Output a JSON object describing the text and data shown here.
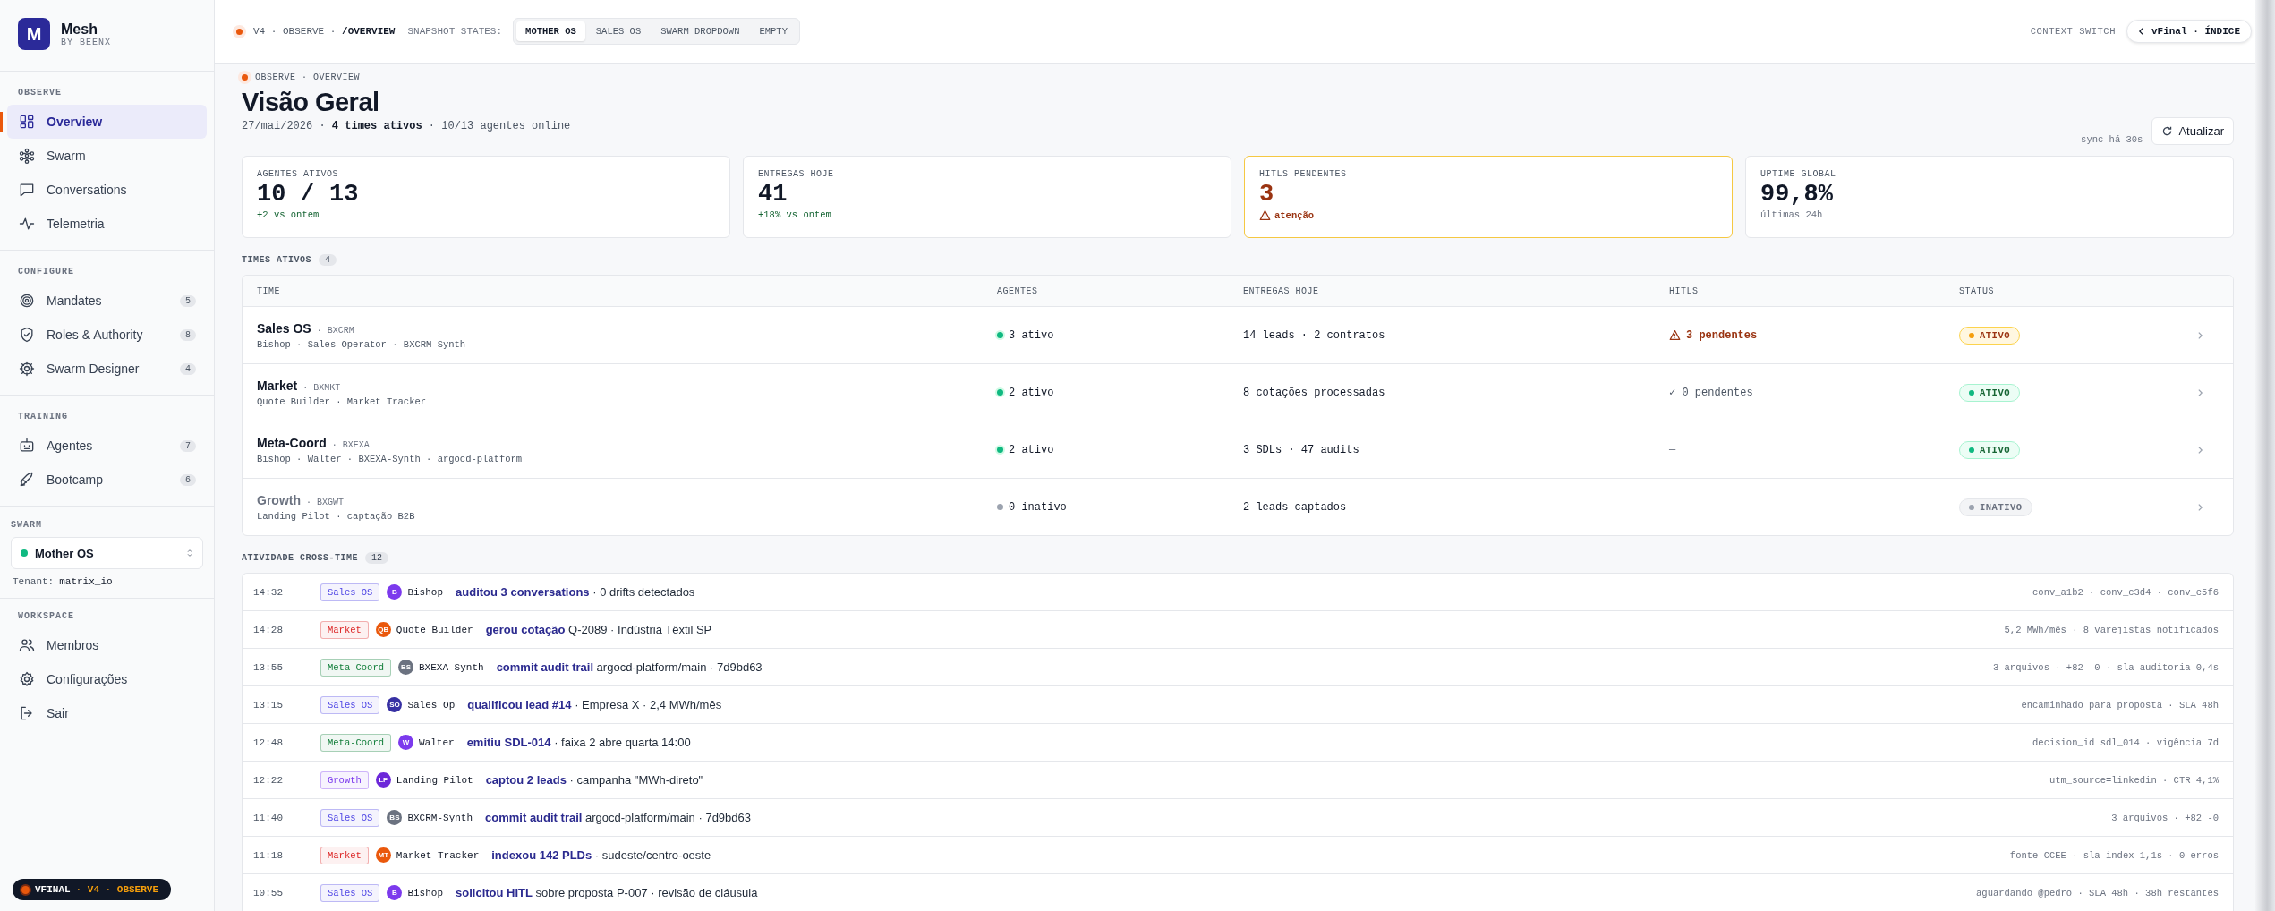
{
  "sidebar": {
    "brand": {
      "logo": "M",
      "name": "Mesh",
      "sub": "BY BEENX"
    },
    "sections": [
      {
        "title": "OBSERVE",
        "items": [
          {
            "label": "Overview",
            "selected": true
          },
          {
            "label": "Swarm",
            "selected": false
          },
          {
            "label": "Conversations",
            "selected": false
          },
          {
            "label": "Telemetria",
            "selected": false
          }
        ]
      },
      {
        "title": "CONFIGURE",
        "items": [
          {
            "label": "Mandates",
            "count": "5",
            "selected": false
          },
          {
            "label": "Roles & Authority",
            "count": "8",
            "selected": false
          },
          {
            "label": "Swarm Designer",
            "count": "4",
            "selected": false
          }
        ]
      },
      {
        "title": "TRAINING",
        "items": [
          {
            "label": "Agentes",
            "count": "7",
            "selected": false
          },
          {
            "label": "Bootcamp",
            "count": "6",
            "selected": false
          }
        ]
      }
    ],
    "swarm": {
      "title": "SWARM",
      "value": "Mother OS",
      "color": "#10b981",
      "tenant_label": "Tenant:",
      "tenant": "matrix_io"
    },
    "workspace": {
      "title": "WORKSPACE",
      "items": [
        {
          "label": "Membros",
          "selected": false
        },
        {
          "label": "Configurações",
          "selected": false
        },
        {
          "label": "Sair",
          "selected": false
        }
      ]
    },
    "footer": {
      "primary": "VFINAL",
      "secondary": "· V4 · OBSERVE"
    }
  },
  "topbar": {
    "breadcrumb": "V4 · OBSERVE · **/OVERVIEW**",
    "snapshot_label": "SNAPSHOT STATES:",
    "snapshots": [
      {
        "label": "MOTHER OS",
        "selected": true
      },
      {
        "label": "SALES OS",
        "selected": false
      },
      {
        "label": "SWARM DROPDOWN",
        "selected": false
      },
      {
        "label": "EMPTY",
        "selected": false
      }
    ],
    "context_label": "CONTEXT SWITCH",
    "back_link": "vFinal · ÍNDICE"
  },
  "header": {
    "eyebrow": "OBSERVE · OVERVIEW",
    "title": "Visão Geral",
    "subtitle": "27/mai/2026 · **4 times ativos** · 10/13 agentes online",
    "sync": "sync há 30s",
    "refresh": "Atualizar"
  },
  "stats": [
    {
      "label": "AGENTES ATIVOS",
      "value": "10 / 13",
      "note": "+2 vs ontem",
      "kind": "positive"
    },
    {
      "label": "ENTREGAS HOJE",
      "value": "41",
      "note": "+18% vs ontem",
      "kind": "positive"
    },
    {
      "label": "HITLS PENDENTES",
      "value": "3",
      "note": "atenção",
      "kind": "warning"
    },
    {
      "label": "UPTIME GLOBAL",
      "value": "99,8%",
      "note": "últimas 24h",
      "kind": "neutral"
    }
  ],
  "teams": {
    "title": "TIMES ATIVOS",
    "count": "4",
    "columns": [
      "TIME",
      "AGENTES",
      "ENTREGAS HOJE",
      "HITLS",
      "STATUS"
    ],
    "rows": [
      {
        "name": "Sales OS",
        "code": "· BXCRM",
        "members": "Bishop · Sales Operator · BXCRM-Synth",
        "agents": "3 ativo",
        "active": true,
        "deliveries": "14 leads · 2 contratos",
        "hitls": {
          "text": "3 pendentes",
          "kind": "warning"
        },
        "status": {
          "text": "ATIVO",
          "kind": "warning"
        }
      },
      {
        "name": "Market",
        "code": "· BXMKT",
        "members": "Quote Builder · Market Tracker",
        "agents": "2 ativo",
        "active": true,
        "deliveries": "8 cotações processadas",
        "hitls": {
          "text": "✓ 0 pendentes",
          "kind": "ok"
        },
        "status": {
          "text": "ATIVO",
          "kind": "ok"
        }
      },
      {
        "name": "Meta-Coord",
        "code": "· BXEXA",
        "members": "Bishop · Walter · BXEXA-Synth · argocd-platform",
        "agents": "2 ativo",
        "active": true,
        "deliveries": "3 SDLs · 47 audits",
        "hitls": {
          "text": "—",
          "kind": "none"
        },
        "status": {
          "text": "ATIVO",
          "kind": "ok"
        }
      },
      {
        "name": "Growth",
        "code": "· BXGWT",
        "members": "Landing Pilot · captação B2B",
        "agents": "0 inativo",
        "active": false,
        "deliveries": "2 leads captados",
        "hitls": {
          "text": "—",
          "kind": "none"
        },
        "status": {
          "text": "INATIVO",
          "kind": "off"
        }
      }
    ]
  },
  "activity": {
    "title": "ATIVIDADE CROSS-TIME",
    "count": "12",
    "rows": [
      {
        "time": "14:32",
        "tag": {
          "label": "Sales OS",
          "color": "#4f46e5"
        },
        "avatar": {
          "initials": "B",
          "color": "#7c3aed"
        },
        "agent": "Bishop",
        "message": "**auditou 3 conversations** · 0 drifts detectados",
        "meta": "conv_a1b2 · conv_c3d4 · conv_e5f6"
      },
      {
        "time": "14:28",
        "tag": {
          "label": "Market",
          "color": "#dc2626"
        },
        "avatar": {
          "initials": "QB",
          "color": "#ea580c"
        },
        "agent": "Quote Builder",
        "message": "**gerou cotação** Q-2089 · Indústria Têxtil SP",
        "meta": "5,2 MWh/mês · 8 varejistas notificados"
      },
      {
        "time": "13:55",
        "tag": {
          "label": "Meta-Coord",
          "color": "#15803d"
        },
        "avatar": {
          "initials": "BS",
          "color": "#6b7280"
        },
        "agent": "BXEXA-Synth",
        "message": "**commit audit trail** argocd-platform/main · 7d9bd63",
        "meta": "3 arquivos · +82 -0 · sla auditoria 0,4s"
      },
      {
        "time": "13:15",
        "tag": {
          "label": "Sales OS",
          "color": "#4f46e5"
        },
        "avatar": {
          "initials": "SO",
          "color": "#3730a3"
        },
        "agent": "Sales Op",
        "message": "**qualificou lead #14** · Empresa X · 2,4 MWh/mês",
        "meta": "encaminhado para proposta · SLA 48h"
      },
      {
        "time": "12:48",
        "tag": {
          "label": "Meta-Coord",
          "color": "#15803d"
        },
        "avatar": {
          "initials": "W",
          "color": "#7c3aed"
        },
        "agent": "Walter",
        "message": "**emitiu SDL-014** · faixa 2 abre quarta 14:00",
        "meta": "decision_id sdl_014 · vigência 7d"
      },
      {
        "time": "12:22",
        "tag": {
          "label": "Growth",
          "color": "#7c3aed"
        },
        "avatar": {
          "initials": "LP",
          "color": "#6d28d9"
        },
        "agent": "Landing Pilot",
        "message": "**captou 2 leads** · campanha \"MWh-direto\"",
        "meta": "utm_source=linkedin · CTR 4,1%"
      },
      {
        "time": "11:40",
        "tag": {
          "label": "Sales OS",
          "color": "#4f46e5"
        },
        "avatar": {
          "initials": "BS",
          "color": "#6b7280"
        },
        "agent": "BXCRM-Synth",
        "message": "**commit audit trail** argocd-platform/main · 7d9bd63",
        "meta": "3 arquivos · +82 -0"
      },
      {
        "time": "11:18",
        "tag": {
          "label": "Market",
          "color": "#dc2626"
        },
        "avatar": {
          "initials": "MT",
          "color": "#ea580c"
        },
        "agent": "Market Tracker",
        "message": "**indexou 142 PLDs** · sudeste/centro-oeste",
        "meta": "fonte CCEE · sla index 1,1s · 0 erros"
      },
      {
        "time": "10:55",
        "tag": {
          "label": "Sales OS",
          "color": "#4f46e5"
        },
        "avatar": {
          "initials": "B",
          "color": "#7c3aed"
        },
        "agent": "Bishop",
        "message": "**solicitou HITL** sobre proposta P-007 · revisão de cláusula",
        "meta": "aguardando @pedro · SLA 48h · 38h restantes"
      }
    ]
  }
}
